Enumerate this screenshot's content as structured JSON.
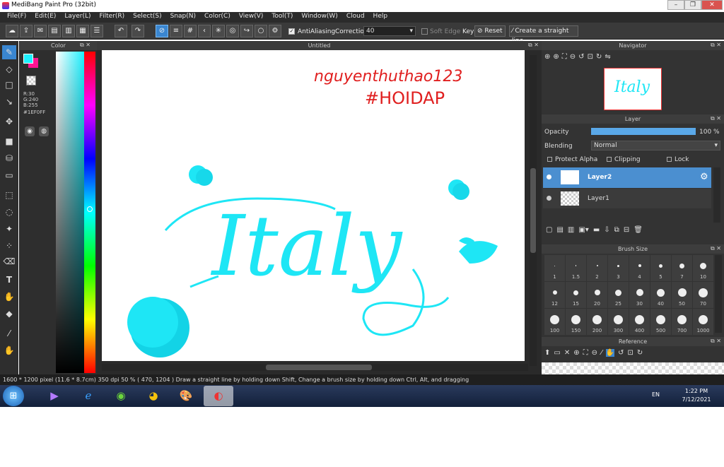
{
  "window": {
    "title": "MediBang Paint Pro (32bit)"
  },
  "menu": [
    "File(F)",
    "Edit(E)",
    "Layer(L)",
    "Filter(R)",
    "Select(S)",
    "Snap(N)",
    "Color(C)",
    "View(V)",
    "Tool(T)",
    "Window(W)",
    "Cloud",
    "Help"
  ],
  "toolbar": {
    "antialiasing": "AntiAliasing",
    "correction_label": "Correction",
    "correction_value": "40",
    "soft_edge": "Soft Edge",
    "key": "Key",
    "reset": "Reset",
    "straight": "Create a straight line"
  },
  "color_panel": {
    "title": "Color",
    "r": "R:30",
    "g": "G:240",
    "b": "B:255",
    "hex": "#1EF0FF",
    "accent": "#1EF0FF"
  },
  "document": {
    "tab": "Untitled"
  },
  "canvas_text": {
    "user": "nguyenthuthao123",
    "tag": "#HOIDAP",
    "word": "Italy"
  },
  "navigator": {
    "title": "Navigator",
    "thumb_text": "Italy"
  },
  "layer_panel": {
    "title": "Layer",
    "opacity_label": "Opacity",
    "opacity_value": "100 %",
    "opacity_level": 1.0,
    "blending_label": "Blending",
    "blending_value": "Normal",
    "protect_alpha": "Protect Alpha",
    "clipping": "Clipping",
    "lock": "Lock",
    "layers": [
      {
        "name": "Layer2"
      },
      {
        "name": "Layer1"
      }
    ]
  },
  "brush_panel": {
    "title": "Brush Size",
    "row1": [
      "1",
      "1.5",
      "2",
      "3",
      "4",
      "5",
      "7",
      "10"
    ],
    "row2": [
      "12",
      "15",
      "20",
      "25",
      "30",
      "40",
      "50",
      "70"
    ],
    "row3": [
      "100",
      "150",
      "200",
      "300",
      "400",
      "500",
      "700",
      "1000"
    ]
  },
  "reference": {
    "title": "Reference"
  },
  "status": {
    "size": "1600 * 1200 pixel",
    "cm": "(11.6 * 8.7cm)",
    "dpi": "350 dpi",
    "zoom": "50 %",
    "coords": "( 470, 1204 )",
    "hint": "Draw a straight line by holding down Shift, Change a brush size by holding down Ctrl, Alt, and dragging"
  },
  "taskbar": {
    "lang": "EN",
    "time": "1:22 PM",
    "date": "7/12/2021"
  }
}
